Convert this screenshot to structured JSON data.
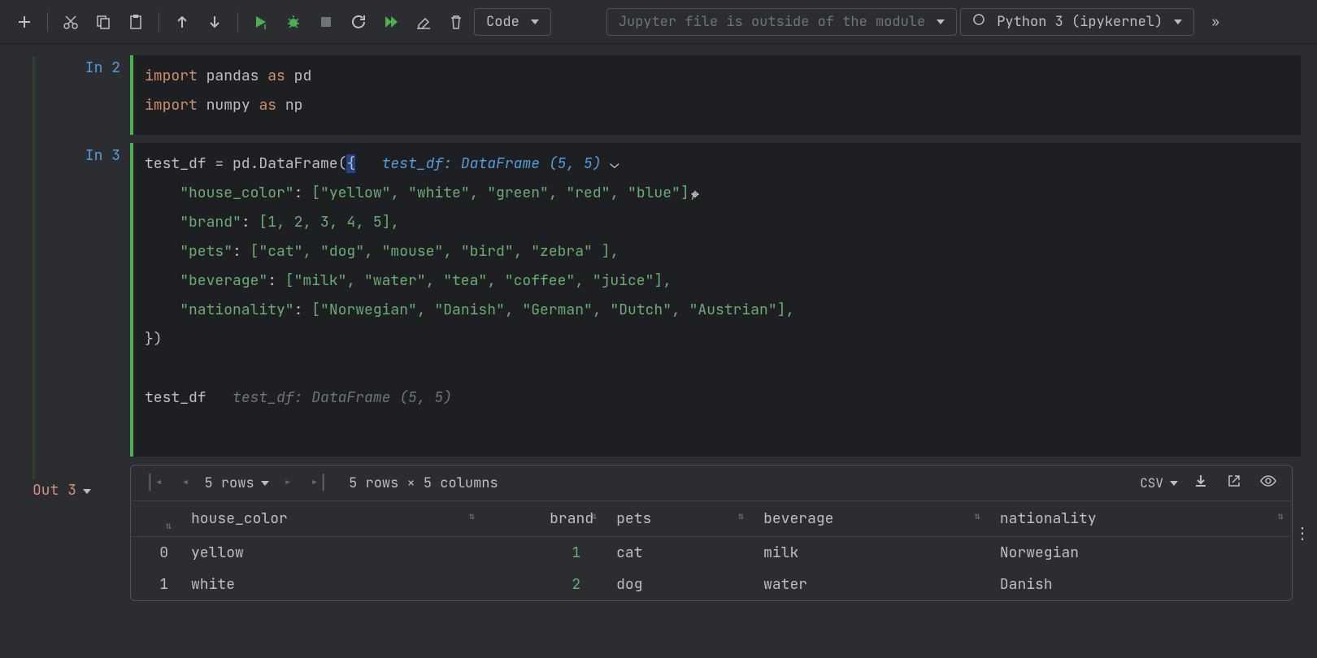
{
  "toolbar": {
    "cell_type": "Code",
    "module_hint": "Jupyter file is outside of the module",
    "kernel": "Python 3 (ipykernel)"
  },
  "cells": {
    "in2": {
      "prompt": "In 2",
      "l1_kw": "import",
      "l1_mod": "pandas",
      "l1_as": "as",
      "l1_al": "pd",
      "l2_kw": "import",
      "l2_mod": "numpy",
      "l2_as": "as",
      "l2_al": "np"
    },
    "in3": {
      "prompt": "In 3",
      "hint1": "test_df: DataFrame (5, 5)",
      "hint2": "test_df: DataFrame (5, 5)",
      "var": "test_df",
      "line0": "test_df = pd.DataFrame(",
      "brace": "{",
      "k_hc": "\"house_color\"",
      "v_hc": "[\"yellow\", \"white\", \"green\", \"red\", \"blue\"],",
      "k_br": "\"brand\"",
      "v_br": "[1, 2, 3, 4, 5],",
      "k_pe": "\"pets\"",
      "v_pe": "[\"cat\", \"dog\", \"mouse\", \"bird\", \"zebra\" ],",
      "k_be": "\"beverage\"",
      "v_be": "[\"milk\", \"water\", \"tea\", \"coffee\", \"juice\"],",
      "k_na": "\"nationality\"",
      "v_na": "[\"Norwegian\", \"Danish\", \"German\", \"Dutch\", \"Austrian\"],",
      "close": "})"
    }
  },
  "output": {
    "prompt": "Out 3",
    "rows_label": "5 rows",
    "summary": "5 rows × 5 columns",
    "export_fmt": "CSV",
    "headers": {
      "idx": "",
      "hc": "house_color",
      "br": "brand",
      "pe": "pets",
      "be": "beverage",
      "na": "nationality"
    },
    "rows": [
      {
        "i": "0",
        "hc": "yellow",
        "br": "1",
        "pe": "cat",
        "be": "milk",
        "na": "Norwegian"
      },
      {
        "i": "1",
        "hc": "white",
        "br": "2",
        "pe": "dog",
        "be": "water",
        "na": "Danish"
      }
    ]
  }
}
